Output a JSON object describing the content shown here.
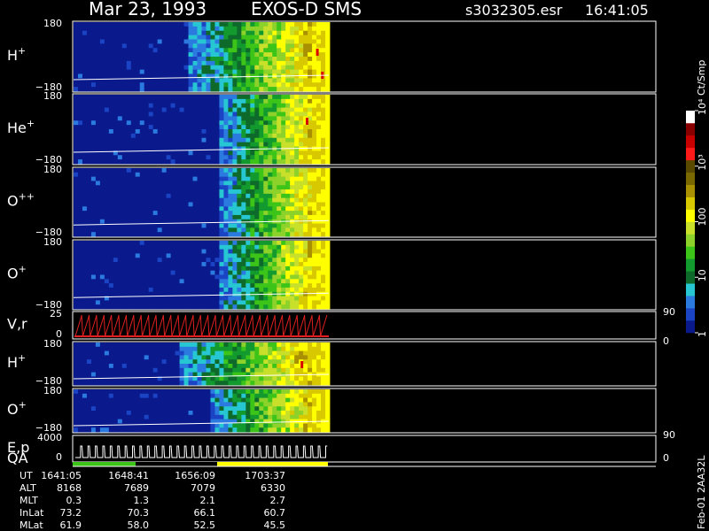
{
  "header": {
    "date": "Mar 23, 1993",
    "instrument": "EXOS-D SMS",
    "file": "s3032305.esr",
    "time": "16:41:05"
  },
  "colorbar": {
    "unit": "Ct/Smp",
    "ticks": [
      {
        "label": "1",
        "value": 1
      },
      {
        "label": "10",
        "value": 10
      },
      {
        "label": "100",
        "value": 100
      },
      {
        "label": "10³",
        "value": 1000
      },
      {
        "label": "10⁴",
        "value": 10000
      }
    ],
    "colors": [
      "#0a1a8c",
      "#1a44c4",
      "#2a7ae0",
      "#26c7d2",
      "#0e6a2a",
      "#129a2e",
      "#3cc418",
      "#8cd22a",
      "#c8e02a",
      "#ffff00",
      "#d8c800",
      "#a89000",
      "#7a6800",
      "#5a4a00",
      "#ff1a1a",
      "#c80000",
      "#8a0000",
      "#ffffff"
    ]
  },
  "side_labels": {
    "zero": "0",
    "ninety": "90"
  },
  "footer_id": "Feb-01 2AA32L",
  "panels": [
    {
      "id": "h-plus-1",
      "label": "H",
      "sup": "+",
      "ymax": "180",
      "ymin": "−180",
      "onset": 0.44,
      "hot": [
        0.95,
        0.97
      ]
    },
    {
      "id": "he-plus",
      "label": "He",
      "sup": "+",
      "ymax": "180",
      "ymin": "−180",
      "onset": 0.56,
      "hot": [
        0.91
      ]
    },
    {
      "id": "o-plus-plus",
      "label": "O",
      "sup": "++",
      "ymax": "180",
      "ymin": "−180",
      "onset": 0.56,
      "hot": []
    },
    {
      "id": "o-plus-1",
      "label": "O",
      "sup": "+",
      "ymax": "180",
      "ymin": "−180",
      "onset": 0.56,
      "hot": []
    },
    {
      "id": "v-r",
      "label": "V,r",
      "sup": "",
      "ymax": "25",
      "ymin": "0"
    },
    {
      "id": "h-plus-2",
      "label": "H",
      "sup": "+",
      "ymax": "180",
      "ymin": "−180",
      "onset": 0.4,
      "hot": [
        0.89
      ]
    },
    {
      "id": "o-plus-2",
      "label": "O",
      "sup": "+",
      "ymax": "180",
      "ymin": "−180",
      "onset": 0.52,
      "hot": []
    },
    {
      "id": "e-p",
      "label": "E,p",
      "sup": "",
      "ymax": "4000",
      "ymin": "0"
    }
  ],
  "qa_label": "QA",
  "ephemeris": {
    "labels": [
      "UT",
      "ALT",
      "MLT",
      "InLat",
      "MLat"
    ],
    "columns": [
      [
        "1641:05",
        "8168",
        "0.3",
        "73.2",
        "61.9"
      ],
      [
        "1648:41",
        "7689",
        "1.3",
        "70.3",
        "58.0"
      ],
      [
        "1656:09",
        "7079",
        "2.1",
        "66.1",
        "52.5"
      ],
      [
        "1703:37",
        "6330",
        "2.7",
        "60.7",
        "45.5"
      ]
    ]
  },
  "chart_data": {
    "type": "heatmap",
    "title": "Mar 23, 1993   EXOS-D SMS",
    "x_ticks": [
      "1641:05",
      "1648:41",
      "1656:09",
      "1703:37"
    ],
    "data_extent_fraction": 0.985,
    "colorbar_range": [
      1,
      10000
    ],
    "series": [
      {
        "name": "H+",
        "ylim": [
          -180,
          180
        ]
      },
      {
        "name": "He+",
        "ylim": [
          -180,
          180
        ]
      },
      {
        "name": "O++",
        "ylim": [
          -180,
          180
        ]
      },
      {
        "name": "O+",
        "ylim": [
          -180,
          180
        ]
      },
      {
        "name": "V,r",
        "ylim": [
          0,
          25
        ],
        "right_ylim": [
          0,
          90
        ]
      },
      {
        "name": "H+",
        "ylim": [
          -180,
          180
        ]
      },
      {
        "name": "O+",
        "ylim": [
          -180,
          180
        ]
      },
      {
        "name": "E,p",
        "ylim": [
          0,
          4000
        ],
        "right_ylim": [
          0,
          90
        ]
      }
    ]
  }
}
